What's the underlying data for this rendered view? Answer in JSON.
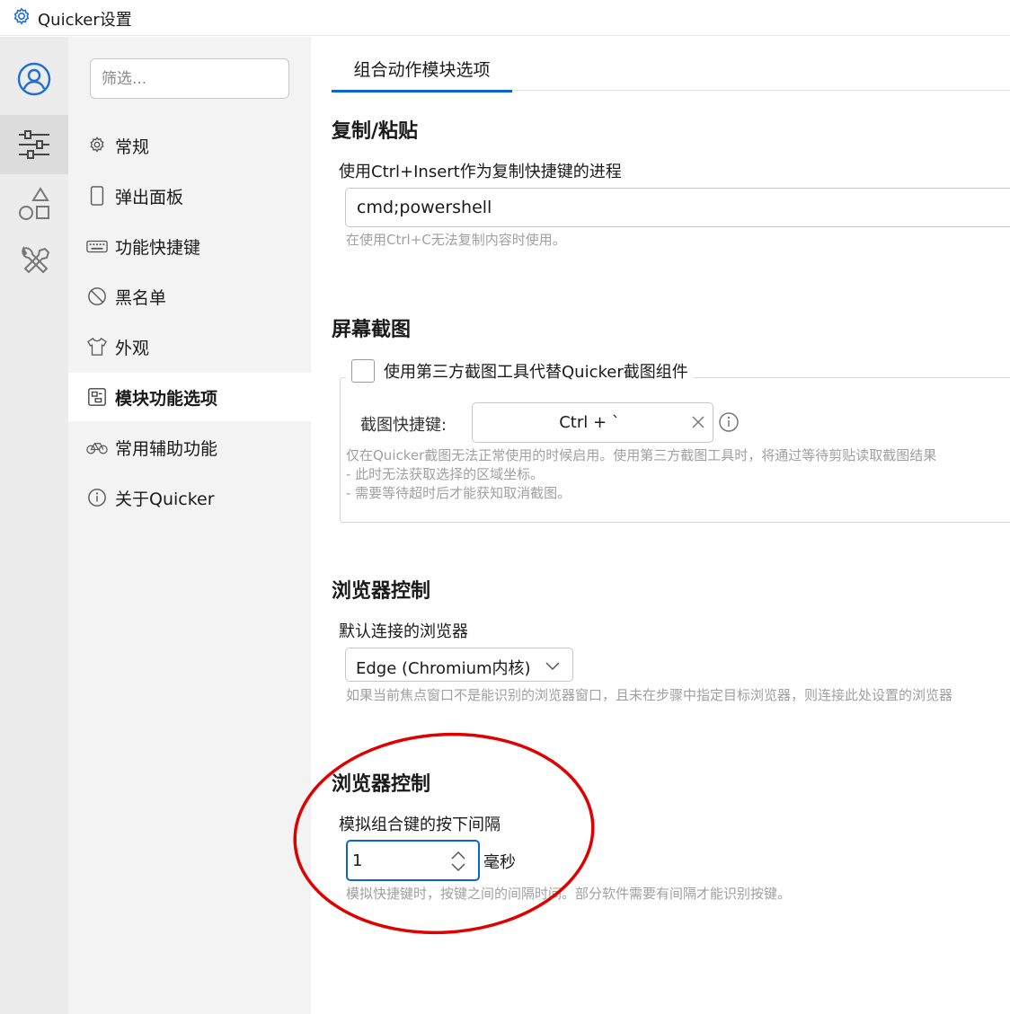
{
  "window": {
    "title": "Quicker设置",
    "icon": "gear-icon"
  },
  "rail": {
    "items": [
      {
        "icon": "user-avatar-icon",
        "active": false
      },
      {
        "icon": "sliders-icon",
        "active": true
      },
      {
        "icon": "shapes-icon",
        "active": false
      },
      {
        "icon": "tools-icon",
        "active": false
      }
    ]
  },
  "nav": {
    "filter_placeholder": "筛选...",
    "items": [
      {
        "label": "常规",
        "icon": "gear-icon"
      },
      {
        "label": "弹出面板",
        "icon": "panel-icon"
      },
      {
        "label": "功能快捷键",
        "icon": "keyboard-icon"
      },
      {
        "label": "黑名单",
        "icon": "block-icon"
      },
      {
        "label": "外观",
        "icon": "tshirt-icon"
      },
      {
        "label": "模块功能选项",
        "icon": "module-icon",
        "active": true
      },
      {
        "label": "常用辅助功能",
        "icon": "bicycle-icon"
      },
      {
        "label": "关于Quicker",
        "icon": "info-icon"
      }
    ]
  },
  "main": {
    "tab": "组合动作模块选项",
    "copy_paste": {
      "title": "复制/粘贴",
      "label": "使用Ctrl+Insert作为复制快捷键的进程",
      "value": "cmd;powershell",
      "hint": "在使用Ctrl+C无法复制内容时使用。"
    },
    "screenshot": {
      "title": "屏幕截图",
      "checkbox_label": "使用第三方截图工具代替Quicker截图组件",
      "checked": false,
      "hotkey_label": "截图快捷键:",
      "hotkey_value": "Ctrl + `",
      "hint_lines": [
        "仅在Quicker截图无法正常使用的时候启用。使用第三方截图工具时，将通过等待剪贴读取截图结果",
        "- 此时无法获取选择的区域坐标。",
        "- 需要等待超时后才能获知取消截图。"
      ]
    },
    "browser": {
      "title": "浏览器控制",
      "label": "默认连接的浏览器",
      "selected": "Edge (Chromium内核)",
      "hint": "如果当前焦点窗口不是能识别的浏览器窗口，且未在步骤中指定目标浏览器，则连接此处设置的浏览器"
    },
    "key_interval": {
      "title": "浏览器控制",
      "label": "模拟组合键的按下间隔",
      "value": "1",
      "unit": "毫秒",
      "hint": "模拟快捷键时，按键之间的间隔时间。部分软件需要有间隔才能识别按键。"
    }
  },
  "colors": {
    "accent": "#0a64d8",
    "annotation": "#e00000",
    "rail_bg": "#ececec",
    "nav_bg": "#f3f3f3"
  }
}
